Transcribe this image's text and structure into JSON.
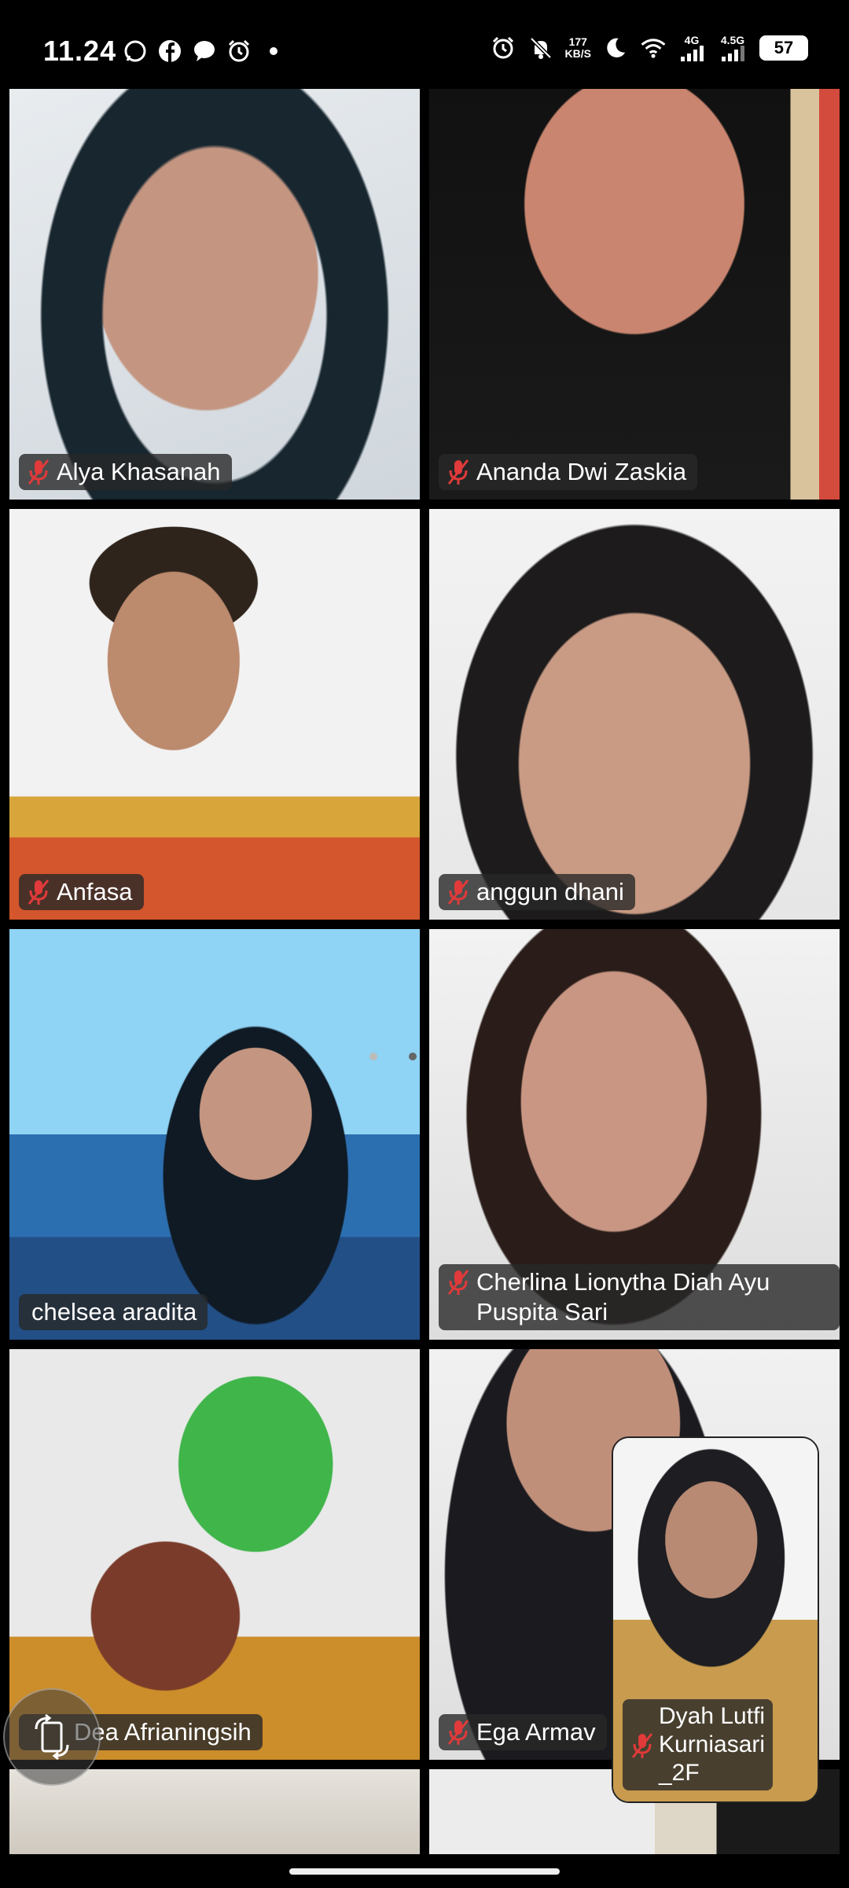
{
  "status_bar": {
    "time": "11.24",
    "left_icons": [
      "whatsapp-icon",
      "facebook-icon",
      "messenger-icon",
      "alarm-icon",
      "dot"
    ],
    "right_icons": [
      "alarm-icon",
      "mute-icon",
      "speed",
      "moon-icon",
      "wifi-icon",
      "signal-4g-icon",
      "signal-4-5g-icon",
      "battery"
    ],
    "speed_value": "177",
    "speed_unit": "KB/S",
    "network_1": "4G",
    "network_2": "4.5G",
    "battery_level": "57"
  },
  "participants": [
    {
      "name": "Alya Khasanah",
      "muted": true
    },
    {
      "name": "Ananda Dwi Zaskia",
      "muted": true
    },
    {
      "name": "Anfasa",
      "muted": true
    },
    {
      "name": "anggun dhani",
      "muted": true
    },
    {
      "name": "chelsea aradita",
      "muted": false,
      "active_speaker": true
    },
    {
      "name": "Cherlina Lionytha Diah Ayu Puspita Sari",
      "muted": true
    },
    {
      "name": "Dea Afrianingsih",
      "muted": false
    },
    {
      "name": "Ega Armav",
      "muted": true
    }
  ],
  "self_view": {
    "name_line1": "Dyah Lutfi",
    "name_line2": "Kurniasari",
    "name_line3": "_2F",
    "muted": true
  },
  "pager": {
    "pages": 2,
    "current": 1
  },
  "colors": {
    "active_speaker_border": "#2ecc40",
    "mute_icon": "#e03a3a",
    "name_tag_bg": "#282828"
  }
}
